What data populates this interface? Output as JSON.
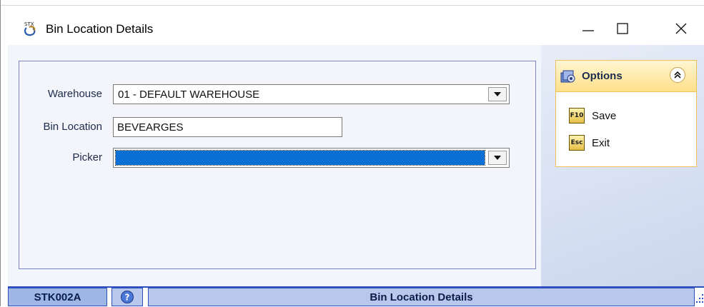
{
  "window": {
    "title": "Bin Location Details",
    "icon": "stx-app-icon",
    "controls": [
      "minimize-icon",
      "maximize-icon",
      "close-icon"
    ]
  },
  "form": {
    "warehouse": {
      "label": "Warehouse",
      "value": "01 - DEFAULT WAREHOUSE"
    },
    "bin_location": {
      "label": "Bin Location",
      "value": "BEVEARGES"
    },
    "picker": {
      "label": "Picker",
      "value": ""
    }
  },
  "options": {
    "title": "Options",
    "items": [
      {
        "key": "F10",
        "label": "Save"
      },
      {
        "key": "Esc",
        "label": "Exit"
      }
    ]
  },
  "statusbar": {
    "code": "STK002A",
    "title": "Bin Location Details"
  },
  "colors": {
    "selection": "#0a70d6",
    "status_blue": "#2f4fbf",
    "options_header": "#ffe08a"
  }
}
